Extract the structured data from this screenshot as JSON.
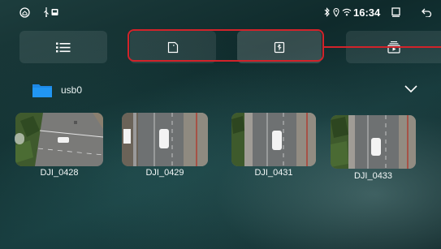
{
  "status_bar": {
    "home_icon": "home-icon",
    "usb_icon": "usb-icon",
    "sd_icon": "sd-card-icon",
    "bluetooth_icon": "bluetooth-icon",
    "location_icon": "location-pin-icon",
    "wifi_icon": "wifi-icon",
    "time": "16:34",
    "window_icon": "window-icon",
    "back_icon": "back-arrow-icon"
  },
  "toolbar": {
    "list_view_icon": "list-icon",
    "tabs": [
      {
        "icon": "sd-card-outline-icon",
        "active": false
      },
      {
        "icon": "usb-drive-icon",
        "active": true
      },
      {
        "icon": "video-folder-icon",
        "active": false
      }
    ],
    "highlight_color": "#d2232a"
  },
  "folder": {
    "name": "usb0",
    "icon": "folder-icon",
    "expand_icon": "chevron-down-icon",
    "folder_color": "#1e88e5"
  },
  "files": [
    {
      "name": "DJI_0428"
    },
    {
      "name": "DJI_0429"
    },
    {
      "name": "DJI_0431"
    },
    {
      "name": "DJI_0433"
    }
  ]
}
